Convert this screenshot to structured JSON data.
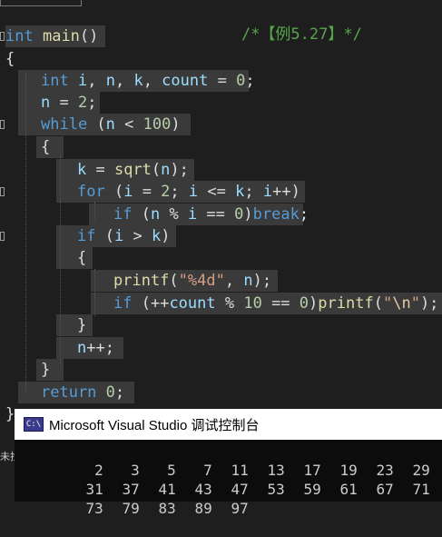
{
  "editor": {
    "comment": "/*【例5.27】*/",
    "lines": {
      "main_type": "int",
      "main_name": "main",
      "main_parens": "()",
      "open_brace": "{",
      "decl_type": "int",
      "decl_rest_i": "i",
      "decl_rest_n": "n",
      "decl_rest_k": "k",
      "decl_rest_count": "count",
      "decl_zero": "0",
      "assign_n": "n",
      "assign_val": "2",
      "while_kw": "while",
      "while_var": "n",
      "while_num": "100",
      "inner_open": "{",
      "k_var": "k",
      "sqrt_fn": "sqrt",
      "sqrt_arg": "n",
      "for_kw": "for",
      "for_i1": "i",
      "for_two": "2",
      "for_i2": "i",
      "for_k": "k",
      "for_i3": "i",
      "if_kw": "if",
      "if_n": "n",
      "if_i": "i",
      "if_zero": "0",
      "break_kw": "break",
      "if2_kw": "if",
      "if2_i": "i",
      "if2_k": "k",
      "if_block_open": "{",
      "printf1": "printf",
      "fmt": "\"%4d\"",
      "printf_arg": "n",
      "if3_kw": "if",
      "count_var": "count",
      "ten": "10",
      "zero2": "0",
      "printf2": "printf",
      "quote_open": "\"",
      "newline_esc": "\\n",
      "quote_close": "\"",
      "if_block_close": "}",
      "n_inc": "n",
      "inner_close": "}",
      "return_kw": "return",
      "return_val": "0",
      "close_brace": "}"
    }
  },
  "console": {
    "title": "Microsoft Visual Studio 调试控制台",
    "icon": "console-app-icon",
    "icon_text": "C:\\",
    "rows": [
      [
        "2",
        "3",
        "5",
        "7",
        "11",
        "13",
        "17",
        "19",
        "23",
        "29"
      ],
      [
        "31",
        "37",
        "41",
        "43",
        "47",
        "53",
        "59",
        "61",
        "67",
        "71"
      ],
      [
        "73",
        "79",
        "83",
        "89",
        "97"
      ]
    ]
  },
  "side": {
    "label": "未找"
  },
  "colors": {
    "background": "#1e1e1e",
    "keyword": "#569cd6",
    "variable": "#9cdcfe",
    "number": "#b5cea8",
    "string": "#d69d85",
    "function": "#dcdcaa",
    "comment": "#57a64a"
  }
}
